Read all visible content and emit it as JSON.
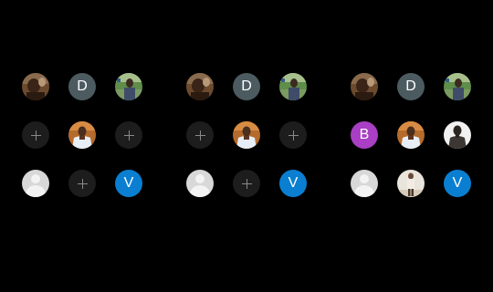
{
  "colors": {
    "background": "#000000",
    "initials_d_bg": "#4c5b60",
    "initials_b_bg": "#a83fc4",
    "initials_v_bg": "#0a7fd1",
    "add_bg": "#1d1d1d",
    "add_plus": "#8a8a8a",
    "empty_bg": "#d8d8d8"
  },
  "icons": {
    "add": "plus-icon",
    "empty_avatar": "person-silhouette-icon"
  },
  "groups": [
    {
      "cells": [
        {
          "kind": "photo",
          "photo": "man-smiling-brown"
        },
        {
          "kind": "initials",
          "text": "D"
        },
        {
          "kind": "photo",
          "photo": "man-outdoor-green"
        },
        {
          "kind": "add"
        },
        {
          "kind": "photo",
          "photo": "man-white-shirt"
        },
        {
          "kind": "add"
        },
        {
          "kind": "empty"
        },
        {
          "kind": "add"
        },
        {
          "kind": "initials",
          "text": "V"
        }
      ]
    },
    {
      "cells": [
        {
          "kind": "photo",
          "photo": "man-smiling-brown"
        },
        {
          "kind": "initials",
          "text": "D"
        },
        {
          "kind": "photo",
          "photo": "man-outdoor-green"
        },
        {
          "kind": "add"
        },
        {
          "kind": "photo",
          "photo": "man-white-shirt"
        },
        {
          "kind": "add"
        },
        {
          "kind": "empty"
        },
        {
          "kind": "add"
        },
        {
          "kind": "initials",
          "text": "V"
        }
      ]
    },
    {
      "cells": [
        {
          "kind": "photo",
          "photo": "man-smiling-brown"
        },
        {
          "kind": "initials",
          "text": "D"
        },
        {
          "kind": "photo",
          "photo": "man-outdoor-green"
        },
        {
          "kind": "initials",
          "text": "B"
        },
        {
          "kind": "photo",
          "photo": "man-white-shirt"
        },
        {
          "kind": "photo",
          "photo": "man-dark-white-bg"
        },
        {
          "kind": "empty"
        },
        {
          "kind": "photo",
          "photo": "person-standing-light"
        },
        {
          "kind": "initials",
          "text": "V"
        }
      ]
    }
  ]
}
